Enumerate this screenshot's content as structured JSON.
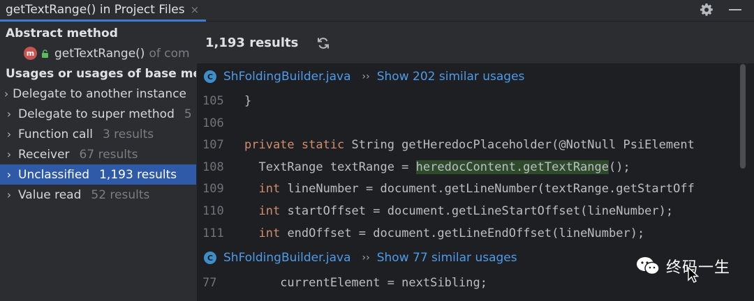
{
  "tab": {
    "title": "getTextRange() in Project Files",
    "close": "×"
  },
  "icons": {
    "settings": "gear-icon",
    "minimize": "minimize-icon",
    "refresh": "refresh-icon"
  },
  "tree": {
    "abstract_header": "Abstract method",
    "method_item": {
      "label": "getTextRange()",
      "suffix": "of com"
    },
    "usages_header": "Usages or usages of base met",
    "groups": [
      {
        "label": "Delegate to another instance",
        "count": ""
      },
      {
        "label": "Delegate to super method",
        "count": "5"
      },
      {
        "label": "Function call",
        "count": "3 results"
      },
      {
        "label": "Receiver",
        "count": "67 results"
      },
      {
        "label": "Unclassified",
        "count": "1,193 results",
        "selected": true
      },
      {
        "label": "Value read",
        "count": "52 results"
      }
    ]
  },
  "preview": {
    "results": "1,193 results",
    "blocks": [
      {
        "file": "ShFoldingBuilder.java",
        "similar": "Show 202 similar usages",
        "lines": [
          {
            "num": "105",
            "indent": "",
            "kw": "",
            "before": "}",
            "match": "",
            "after": ""
          },
          {
            "num": "106",
            "indent": "",
            "kw": "",
            "before": "",
            "match": "",
            "after": ""
          },
          {
            "num": "107",
            "indent": "",
            "kw": "private static",
            "before": " String getHeredocPlaceholder(@NotNull PsiElement",
            "match": "",
            "after": ""
          },
          {
            "num": "108",
            "indent": "  ",
            "kw": "",
            "before": "TextRange textRange = ",
            "match": "heredocContent.getTextRange",
            "after": "();"
          },
          {
            "num": "109",
            "indent": "  ",
            "kw": "int",
            "before": " lineNumber = document.getLineNumber(textRange.getStartOff",
            "match": "",
            "after": ""
          },
          {
            "num": "110",
            "indent": "  ",
            "kw": "int",
            "before": " startOffset = document.getLineStartOffset(lineNumber);",
            "match": "",
            "after": ""
          },
          {
            "num": "111",
            "indent": "  ",
            "kw": "int",
            "before": " endOffset = document.getLineEndOffset(lineNumber);",
            "match": "",
            "after": ""
          }
        ]
      },
      {
        "file": "ShFoldingBuilder.java",
        "similar": "Show 77 similar usages",
        "lines": [
          {
            "num": "77",
            "indent": "     ",
            "kw": "",
            "before": "currentElement = nextSibling;",
            "match": "",
            "after": ""
          }
        ]
      }
    ]
  },
  "watermark": {
    "text": "终码一生"
  }
}
